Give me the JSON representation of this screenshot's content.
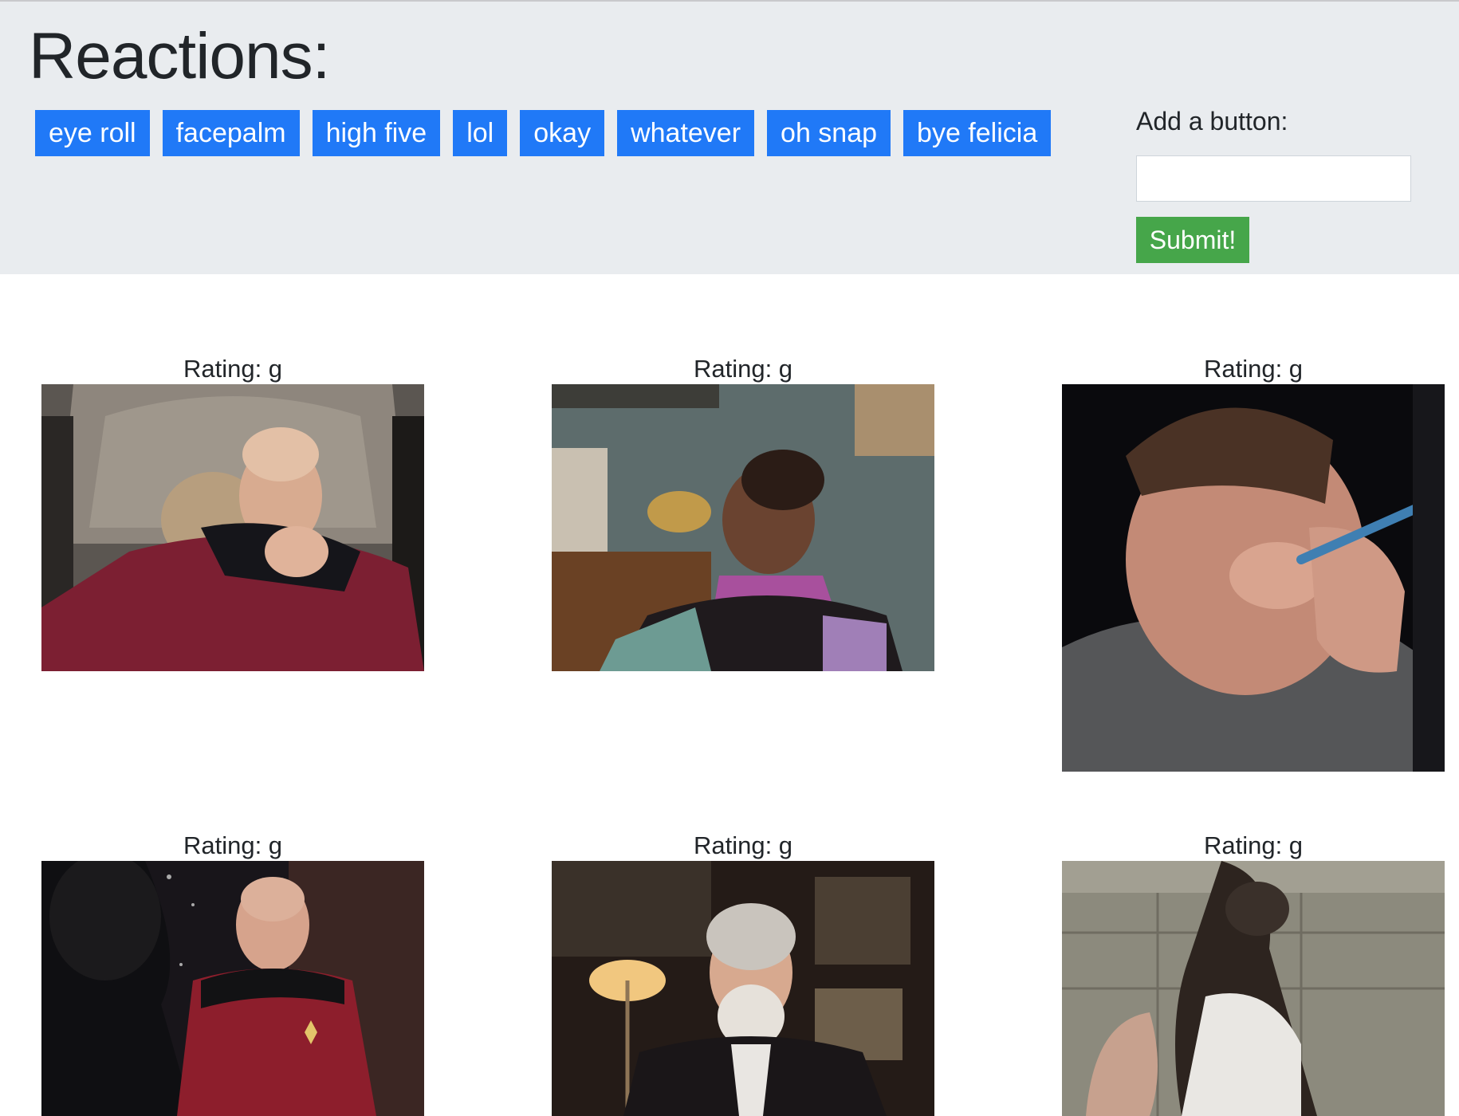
{
  "header": {
    "title": "Reactions:",
    "buttons": [
      "eye roll",
      "facepalm",
      "high five",
      "lol",
      "okay",
      "whatever",
      "oh snap",
      "bye felicia"
    ]
  },
  "add_form": {
    "label": "Add a button:",
    "input_value": "",
    "submit_label": "Submit!"
  },
  "gifs": [
    {
      "rating": "Rating: g",
      "subject": "man in red uniform with hand on chin"
    },
    {
      "rating": "Rating: g",
      "subject": "young girl in purple scarf"
    },
    {
      "rating": "Rating: g",
      "subject": "man rubbing eyes holding pen"
    },
    {
      "rating": "Rating: g",
      "subject": "man in red uniform seated facing another person"
    },
    {
      "rating": "Rating: g",
      "subject": "grey-bearded man in dark suit near lamp"
    },
    {
      "rating": "Rating: g",
      "subject": "animal climbing stone wall"
    }
  ],
  "colors": {
    "header_bg": "#e9ecef",
    "reaction_button": "#2079f7",
    "submit_button": "#46a64a"
  }
}
